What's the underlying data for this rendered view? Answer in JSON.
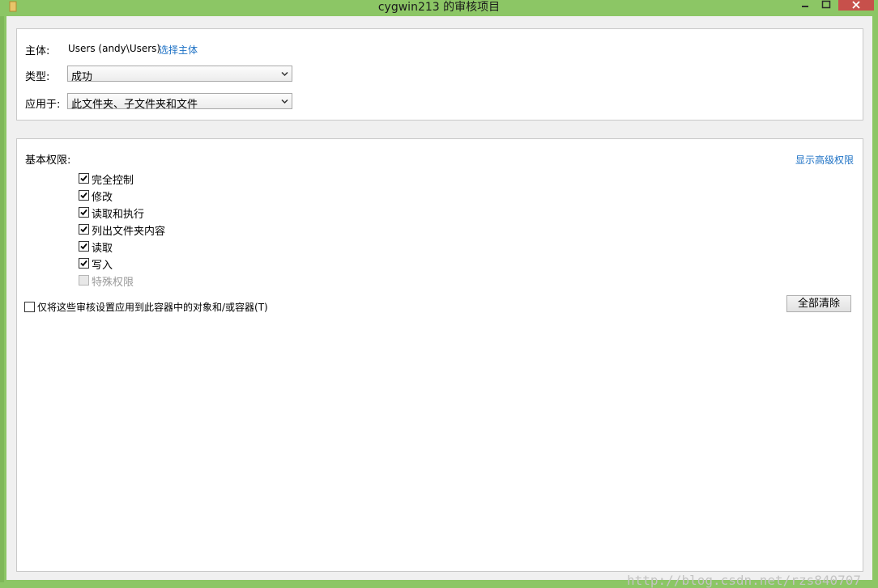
{
  "window": {
    "title": "cygwin213 的审核项目"
  },
  "principal": {
    "label": "主体:",
    "value": "Users (andy\\Users)",
    "select_link": "选择主体"
  },
  "type": {
    "label": "类型:",
    "selected": "成功"
  },
  "applies_to": {
    "label": "应用于:",
    "selected": "此文件夹、子文件夹和文件"
  },
  "permissions": {
    "label": "基本权限:",
    "advanced_link": "显示高级权限",
    "items": [
      {
        "label": "完全控制",
        "checked": true,
        "enabled": true
      },
      {
        "label": "修改",
        "checked": true,
        "enabled": true
      },
      {
        "label": "读取和执行",
        "checked": true,
        "enabled": true
      },
      {
        "label": "列出文件夹内容",
        "checked": true,
        "enabled": true
      },
      {
        "label": "读取",
        "checked": true,
        "enabled": true
      },
      {
        "label": "写入",
        "checked": true,
        "enabled": true
      },
      {
        "label": "特殊权限",
        "checked": false,
        "enabled": false
      }
    ]
  },
  "only_apply": {
    "label": "仅将这些审核设置应用到此容器中的对象和/或容器(T)",
    "checked": false
  },
  "clear_all_button": "全部清除",
  "watermark": "http://blog.csdn.net/rzs840707",
  "colors": {
    "title_bar": "#8cc665",
    "link": "#1e72c5",
    "close_button": "#c7504b"
  }
}
